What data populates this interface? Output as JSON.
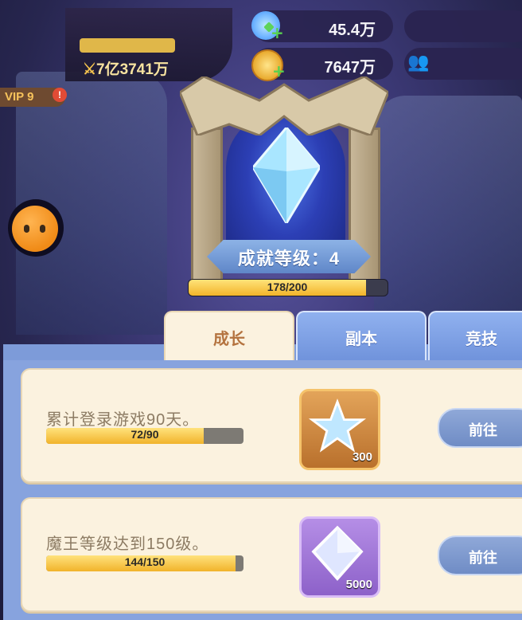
{
  "topbar": {
    "gem_value": "45.4万",
    "gold_value": "7647万",
    "power_value": "7亿3741万",
    "vip_label": "VIP 9",
    "vip_badge": "!"
  },
  "achievement": {
    "level_label": "成就等级：4",
    "progress_text": "178/200",
    "progress_fraction": 0.89
  },
  "tabs": [
    {
      "label": "成长",
      "active": true
    },
    {
      "label": "副本",
      "active": false
    },
    {
      "label": "竞技",
      "active": false
    }
  ],
  "quests": [
    {
      "title": "累计登录游戏90天。",
      "progress_text": "72/90",
      "progress_fraction": 0.8,
      "reward_icon": "star-gem-icon",
      "reward_count": "300",
      "button_label": "前往"
    },
    {
      "title": "魔王等级达到150级。",
      "progress_text": "144/150",
      "progress_fraction": 0.96,
      "reward_icon": "diamond-crystal-icon",
      "reward_count": "5000",
      "button_label": "前往"
    }
  ],
  "colors": {
    "accent_blue": "#7d9bd9",
    "card_bg": "#fbf2df",
    "progress_yellow": "#f2b42a",
    "tab_active_text": "#b4733f"
  }
}
